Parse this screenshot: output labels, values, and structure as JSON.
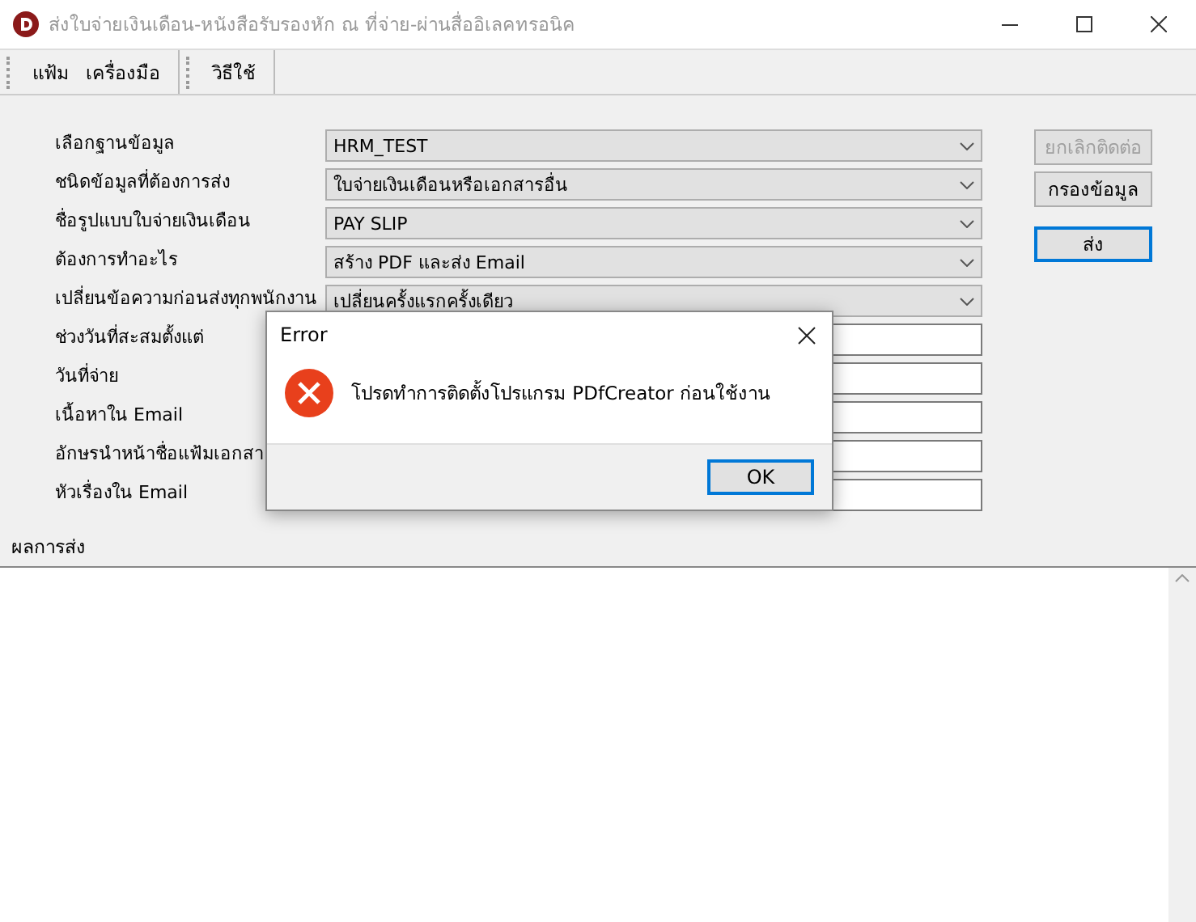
{
  "window": {
    "title": "ส่งใบจ่ายเงินเดือน-หนังสือรับรองหัก ณ ที่จ่าย-ผ่านสื่ออิเลคทรอนิค"
  },
  "menu": [
    {
      "items": [
        "แฟ้ม",
        "เครื่องมือ"
      ]
    },
    {
      "items": [
        "วิธีใช้"
      ]
    }
  ],
  "form": {
    "fields": [
      {
        "label": "เลือกฐานข้อมูล",
        "kind": "combo",
        "value": "HRM_TEST"
      },
      {
        "label": "ชนิดข้อมูลที่ต้องการส่ง",
        "kind": "combo",
        "value": "ใบจ่ายเงินเดือนหรือเอกสารอื่น"
      },
      {
        "label": "ชื่อรูปแบบใบจ่ายเงินเดือน",
        "kind": "combo",
        "value": "PAY SLIP"
      },
      {
        "label": "ต้องการทำอะไร",
        "kind": "combo",
        "value": "สร้าง PDF และส่ง Email"
      },
      {
        "label": "เปลี่ยนข้อความก่อนส่งทุกพนักงาน",
        "kind": "combo",
        "value": "เปลี่ยนครั้งแรกครั้งเดียว"
      },
      {
        "label": "ช่วงวันที่สะสมตั้งแต่",
        "kind": "text"
      },
      {
        "label": "วันที่จ่าย",
        "kind": "text"
      },
      {
        "label": "เนื้อหาใน Email",
        "kind": "text"
      },
      {
        "label": "อักษรนำหน้าชื่อแฟ้มเอกสา",
        "kind": "text"
      },
      {
        "label": "หัวเรื่องใน Email",
        "kind": "text"
      }
    ],
    "buttons": [
      {
        "label": "ยกเลิกติดต่อ",
        "disabled": true,
        "default": false
      },
      {
        "label": "กรองข้อมูล",
        "disabled": false,
        "default": false
      },
      {
        "label": "ส่ง",
        "disabled": false,
        "default": true
      }
    ]
  },
  "result": {
    "label": "ผลการส่ง"
  },
  "dialog": {
    "title": "Error",
    "message": "โปรดทำการติดตั้งโปรแกรม PDfCreator ก่อนใช้งาน",
    "button": "OK"
  }
}
